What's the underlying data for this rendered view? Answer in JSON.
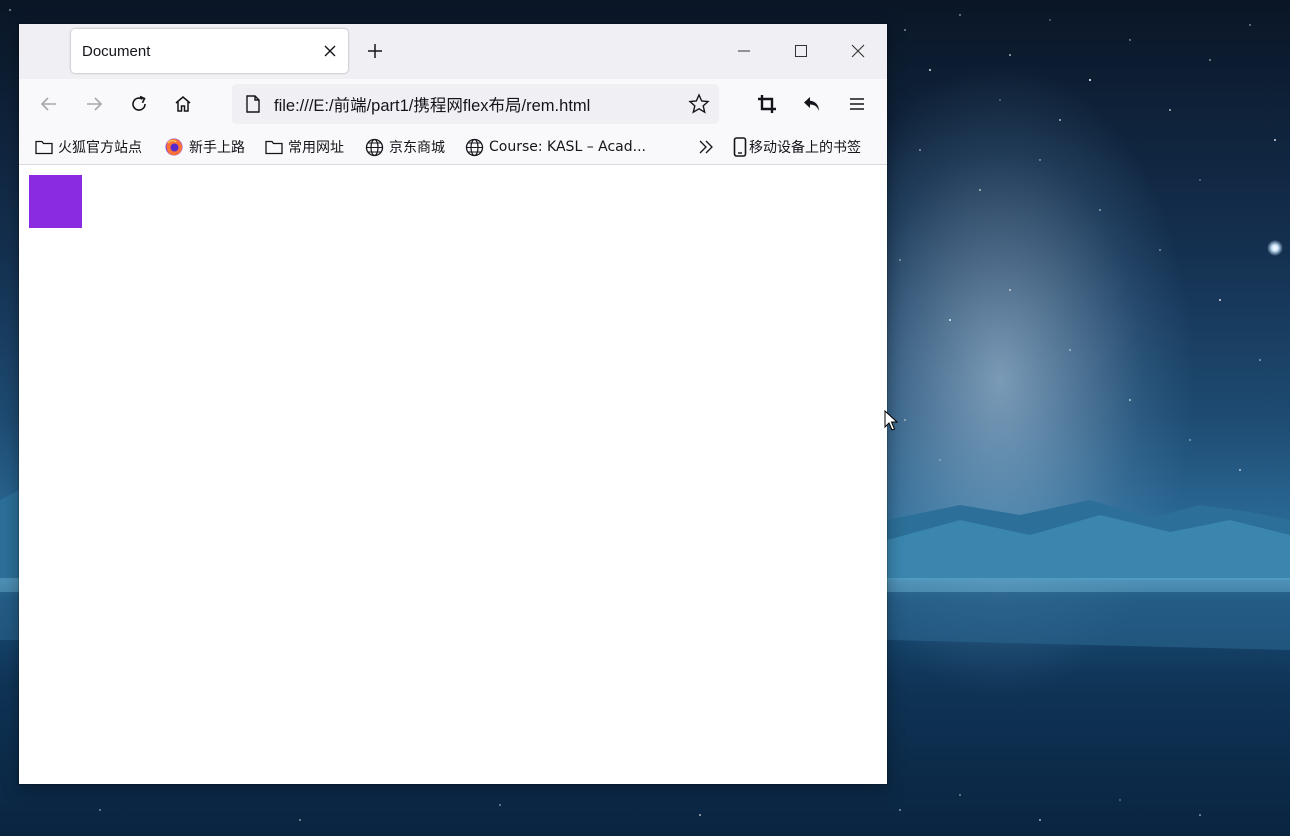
{
  "browser": {
    "tab": {
      "title": "Document"
    },
    "url": "file:///E:/前端/part1/携程网flex布局/rem.html"
  },
  "bookmarks": [
    {
      "label": "火狐官方站点",
      "icon": "folder-icon"
    },
    {
      "label": "新手上路",
      "icon": "firefox-icon"
    },
    {
      "label": "常用网址",
      "icon": "folder-icon"
    },
    {
      "label": "京东商城",
      "icon": "globe-icon"
    },
    {
      "label": "Course: KASL – Acad...",
      "icon": "globe-icon"
    }
  ],
  "mobile_bookmarks": {
    "label": "移动设备上的书签",
    "icon": "mobile-icon"
  },
  "page": {
    "box_color": "#8a2be2"
  },
  "colors": {
    "tabbar": "#f0f0f4",
    "toolbar": "#f9f9fb",
    "text": "#15141a"
  }
}
